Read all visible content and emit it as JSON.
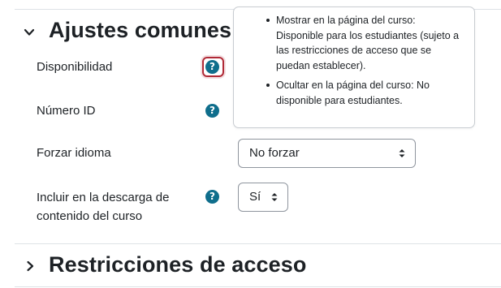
{
  "sections": {
    "general": {
      "title": "Ajustes comunes de"
    },
    "restrictions": {
      "title": "Restricciones de acceso"
    }
  },
  "fields": {
    "availability": {
      "label": "Disponibilidad"
    },
    "id_number": {
      "label": "Número ID"
    },
    "force_language": {
      "label": "Forzar idioma",
      "value": "No forzar"
    },
    "download_content": {
      "label_line1": "Incluir en la descarga de",
      "label_line2": "contenido del curso",
      "value": "Sí"
    }
  },
  "help_icon": {
    "glyph": "?",
    "icon": "question-circle-icon"
  },
  "popover": {
    "items": [
      {
        "line1": "Mostrar en la página del curso:",
        "line2": "Disponible para los estudiantes (sujeto a",
        "line3": "las restricciones de acceso que se",
        "line4": "puedan establecer)."
      },
      {
        "line1": "Ocultar en la página del curso: No",
        "line2": "disponible para estudiantes."
      }
    ]
  },
  "colors": {
    "help_icon": "#0f6e8c",
    "focus_ring": "#b02a37",
    "divider": "#dee2e6"
  }
}
